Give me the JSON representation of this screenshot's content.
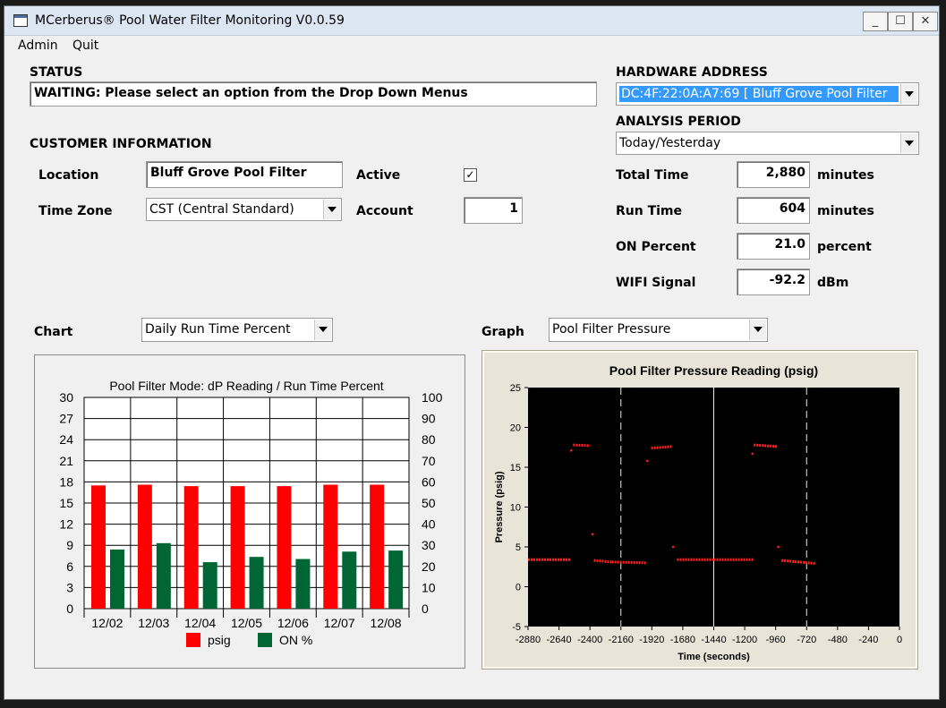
{
  "window": {
    "title": "MCerberus® Pool Water Filter Monitoring V0.0.59"
  },
  "menu": [
    "Admin",
    "Quit"
  ],
  "status": {
    "label": "STATUS",
    "text": "WAITING: Please select an option from the Drop Down Menus"
  },
  "hardware": {
    "label": "HARDWARE ADDRESS",
    "value": "DC:4F:22:0A:A7:69 [ Bluff Grove Pool Filter"
  },
  "analysis": {
    "label": "ANALYSIS PERIOD",
    "value": "Today/Yesterday"
  },
  "customer": {
    "label": "CUSTOMER INFORMATION",
    "location_label": "Location",
    "location_value": "Bluff Grove Pool Filter",
    "timezone_label": "Time Zone",
    "timezone_value": "CST (Central Standard)",
    "active_label": "Active",
    "active_checked": "✓",
    "account_label": "Account",
    "account_value": "1"
  },
  "metrics": [
    {
      "label": "Total Time",
      "value": "2,880",
      "unit": "minutes"
    },
    {
      "label": "Run Time",
      "value": "604",
      "unit": "minutes"
    },
    {
      "label": "ON Percent",
      "value": "21.0",
      "unit": "percent"
    },
    {
      "label": "WIFI Signal",
      "value": "-92.2",
      "unit": "dBm"
    }
  ],
  "chart_select": {
    "label": "Chart",
    "value": "Daily Run Time Percent"
  },
  "graph_select": {
    "label": "Graph",
    "value": "Pool Filter Pressure"
  },
  "colors": {
    "psig": "#ff0000",
    "on": "#006633",
    "graph_bg": "#000000",
    "graph_points": "#ff2020",
    "graph_line": "#f5f0b0"
  },
  "chart_data": [
    {
      "type": "bar",
      "title": "Pool Filter Mode: dP Reading / Run Time Percent",
      "categories": [
        "12/02",
        "12/03",
        "12/04",
        "12/05",
        "12/06",
        "12/07",
        "12/08"
      ],
      "series": [
        {
          "name": "psig",
          "axis": "left",
          "values": [
            17.5,
            17.6,
            17.4,
            17.4,
            17.4,
            17.6,
            17.6
          ]
        },
        {
          "name": "ON %",
          "axis": "right",
          "values": [
            28,
            31,
            22,
            24.5,
            23.5,
            27,
            27.5
          ]
        }
      ],
      "ylim": [
        0,
        30
      ],
      "y2lim": [
        0,
        100
      ],
      "yticks": [
        "0",
        "3",
        "6",
        "9",
        "12",
        "15",
        "18",
        "21",
        "24",
        "27",
        "30"
      ],
      "y2ticks": [
        "0",
        "10",
        "20",
        "30",
        "40",
        "50",
        "60",
        "70",
        "80",
        "90",
        "100"
      ],
      "grid": true,
      "legend": "bottom"
    },
    {
      "type": "scatter",
      "title": "Pool Filter Pressure Reading (psig)",
      "xlabel": "Time (seconds)",
      "ylabel": "Pressure (psig)",
      "xlim": [
        -2880,
        0
      ],
      "ylim": [
        -5,
        25
      ],
      "xticks": [
        "-2880",
        "-2640",
        "-2400",
        "-2160",
        "-1920",
        "-1680",
        "-1440",
        "-1200",
        "-960",
        "-720",
        "-480",
        "-240",
        "0"
      ],
      "yticks": [
        "-5",
        "0",
        "5",
        "10",
        "15",
        "20",
        "25"
      ],
      "segments": [
        {
          "x0": -2880,
          "x1": -2550,
          "y0": 3.4,
          "y1": 3.4
        },
        {
          "x0": -2530,
          "x1": -2400,
          "y0": 17.8,
          "y1": 17.7
        },
        {
          "x0": -2370,
          "x1": -2230,
          "y0": 3.3,
          "y1": 3.1
        },
        {
          "x0": -2230,
          "x1": -1960,
          "y0": 3.1,
          "y1": 3.0
        },
        {
          "x0": -1925,
          "x1": -1760,
          "y0": 17.4,
          "y1": 17.6
        },
        {
          "x0": -1725,
          "x1": -1440,
          "y0": 3.4,
          "y1": 3.4
        },
        {
          "x0": -1440,
          "x1": -1130,
          "y0": 3.4,
          "y1": 3.4
        },
        {
          "x0": -1130,
          "x1": -945,
          "y0": 17.8,
          "y1": 17.6
        },
        {
          "x0": -915,
          "x1": -710,
          "y0": 3.3,
          "y1": 3.0
        },
        {
          "x0": -710,
          "x1": -650,
          "y0": 3.0,
          "y1": 2.9
        }
      ],
      "outliers": [
        {
          "x": -2545,
          "y": 17.1
        },
        {
          "x": -2380,
          "y": 6.6
        },
        {
          "x": -1955,
          "y": 15.8
        },
        {
          "x": -1755,
          "y": 5.0
        },
        {
          "x": -1140,
          "y": 16.7
        },
        {
          "x": -940,
          "y": 5.0
        }
      ],
      "vlines": [
        {
          "x": -2160,
          "style": "dashed"
        },
        {
          "x": -1440,
          "style": "solid"
        },
        {
          "x": -720,
          "style": "dashed"
        }
      ]
    }
  ]
}
